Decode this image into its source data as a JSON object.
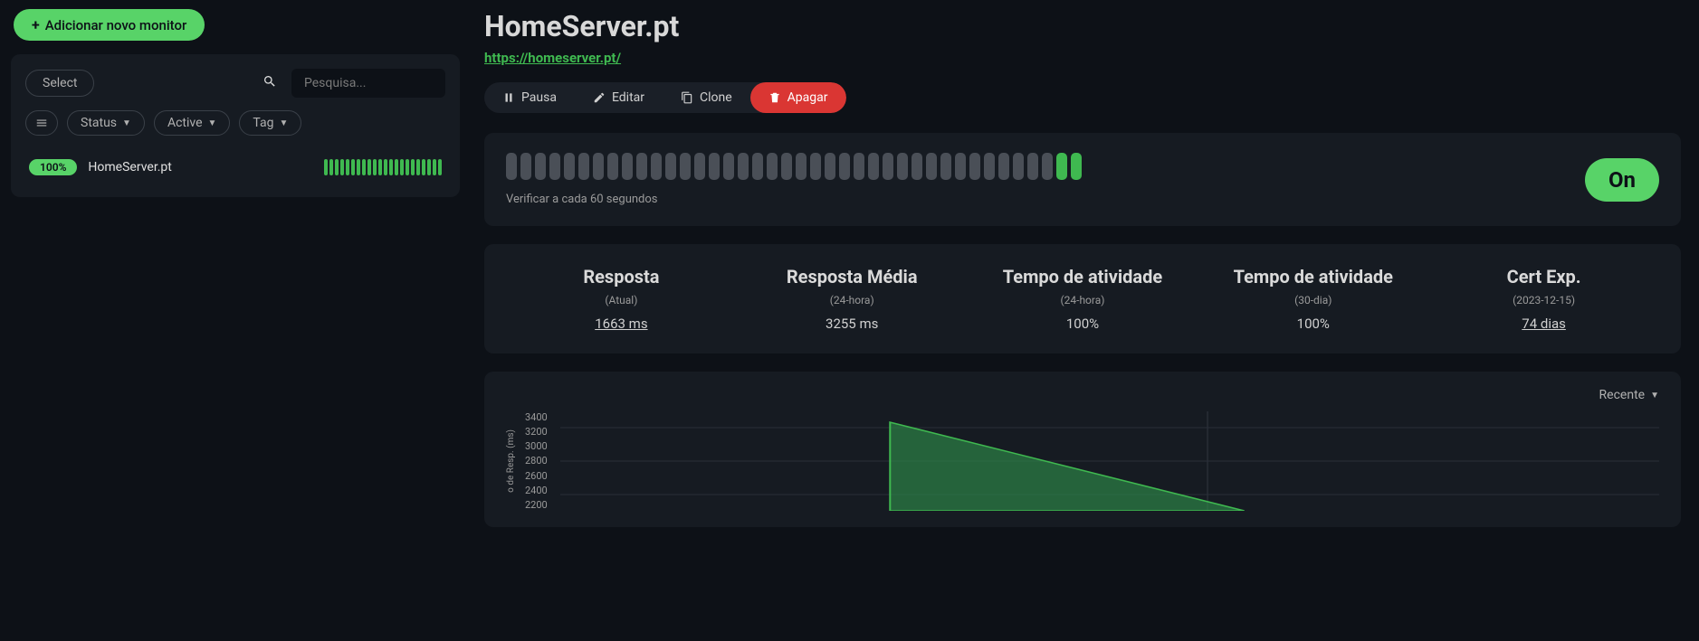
{
  "sidebar": {
    "add_label": "Adicionar novo monitor",
    "select_label": "Select",
    "search_placeholder": "Pesquisa...",
    "filters": {
      "status": "Status",
      "active": "Active",
      "tag": "Tag"
    },
    "monitor": {
      "pct": "100%",
      "name": "HomeServer.pt"
    }
  },
  "main": {
    "title": "HomeServer.pt",
    "url": "https://homeserver.pt/",
    "actions": {
      "pause": "Pausa",
      "edit": "Editar",
      "clone": "Clone",
      "delete": "Apagar"
    },
    "check_label": "Verificar a cada 60 segundos",
    "status_badge": "On",
    "stats": [
      {
        "title": "Resposta",
        "sub": "(Atual)",
        "val": "1663 ms",
        "u": true
      },
      {
        "title": "Resposta Média",
        "sub": "(24-hora)",
        "val": "3255 ms",
        "u": false
      },
      {
        "title": "Tempo de atividade",
        "sub": "(24-hora)",
        "val": "100%",
        "u": false
      },
      {
        "title": "Tempo de atividade",
        "sub": "(30-dia)",
        "val": "100%",
        "u": false
      },
      {
        "title": "Cert Exp.",
        "sub": "(2023-12-15)",
        "val": "74 dias",
        "u": true
      }
    ],
    "chart": {
      "recent_label": "Recente",
      "y_title": "o de Resp. (ms)"
    }
  },
  "chart_data": {
    "type": "area",
    "ylabel": "Tempo de Resp. (ms)",
    "ylim": [
      2200,
      3400
    ],
    "y_ticks": [
      3400,
      3200,
      3000,
      2800,
      2600,
      2400,
      2200
    ],
    "series": [
      {
        "name": "response",
        "values": [
          3255,
          1663
        ]
      }
    ]
  }
}
